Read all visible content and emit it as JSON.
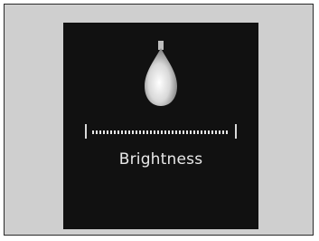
{
  "osd": {
    "icon": "lightbulb-icon",
    "label": "Brightness"
  },
  "colors": {
    "frame_bg": "#cfcfcf",
    "osd_bg": "#111111",
    "text": "#e8e8e8"
  }
}
